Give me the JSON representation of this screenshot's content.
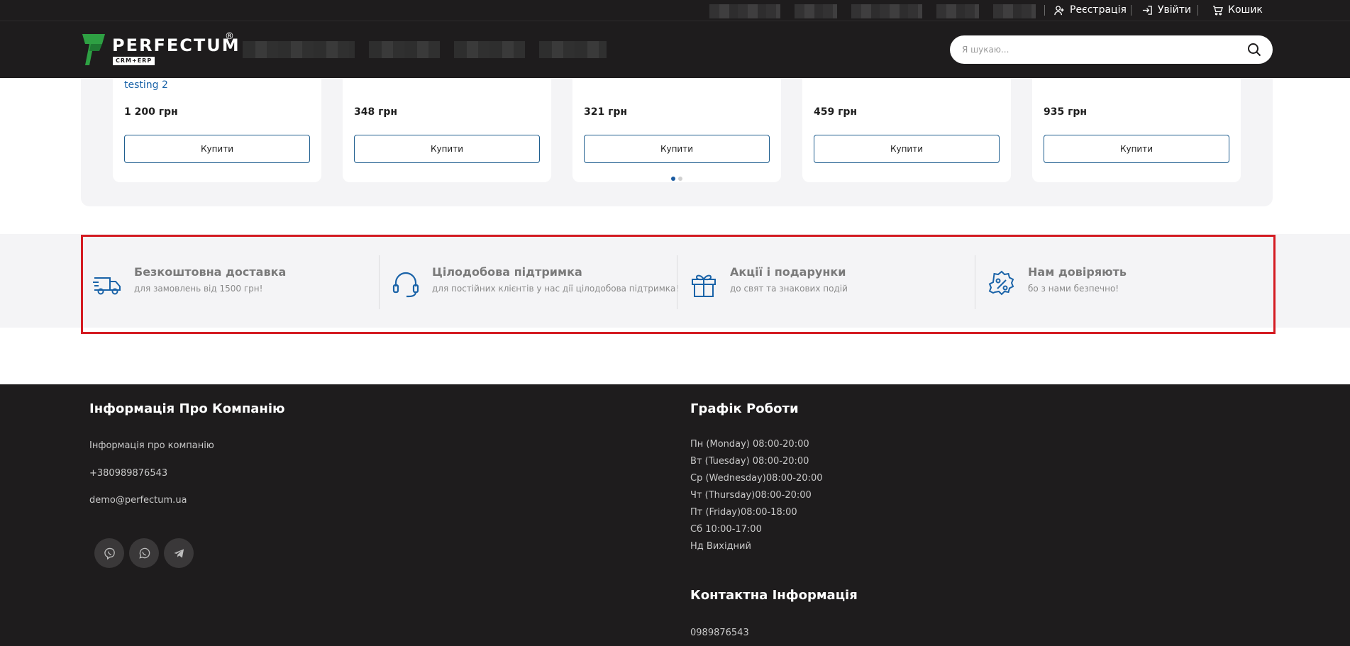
{
  "colors": {
    "dark": "#1e1c1d",
    "accent_blue": "#1a63a8",
    "highlight_red": "#d41b22",
    "logo_green": "#2ea043"
  },
  "topbar": {
    "register_label": "Реєстрація",
    "login_label": "Увійти",
    "cart_label": "Кошик"
  },
  "header": {
    "logo_text": "PERFECTUM",
    "logo_sub": "CRM+ERP",
    "logo_reg": "®",
    "search_placeholder": "Я шукаю..."
  },
  "products": [
    {
      "title": "testing 2",
      "price": "1 200 грн",
      "buy_label": "Купити"
    },
    {
      "title": "",
      "price": "348 грн",
      "buy_label": "Купити"
    },
    {
      "title": "",
      "price": "321 грн",
      "buy_label": "Купити"
    },
    {
      "title": "",
      "price": "459 грн",
      "buy_label": "Купити"
    },
    {
      "title": "",
      "price": "935 грн",
      "buy_label": "Купити"
    }
  ],
  "features": [
    {
      "icon": "delivery-truck-icon",
      "title": "Безкоштовна доставка",
      "subtitle": "для замовлень від 1500 грн!"
    },
    {
      "icon": "headset-icon",
      "title": "Цілодобова підтримка",
      "subtitle": "для постійних клієнтів у нас дії цілодобова підтримка!"
    },
    {
      "icon": "gift-icon",
      "title": "Акції і подарунки",
      "subtitle": "до свят та знакових подій"
    },
    {
      "icon": "percent-badge-icon",
      "title": "Нам довіряють",
      "subtitle": "бо з нами безпечно!"
    }
  ],
  "footer": {
    "company": {
      "heading": "Інформація Про Компанію",
      "links": [
        "Інформація про компанію",
        "+380989876543",
        "demo@perfectum.ua"
      ]
    },
    "schedule": {
      "heading": "Графік Роботи",
      "hours": [
        "Пн (Monday) 08:00-20:00",
        "Вт (Tuesday) 08:00-20:00",
        "Ср (Wednesday)08:00-20:00",
        "Чт (Thursday)08:00-20:00",
        "Пт (Friday)08:00-18:00",
        "Сб 10:00-17:00",
        "Нд Вихідний"
      ]
    },
    "contact": {
      "heading": "Контактна Інформація",
      "phone": "0989876543"
    },
    "socials": [
      "viber-icon",
      "whatsapp-icon",
      "telegram-icon"
    ]
  }
}
